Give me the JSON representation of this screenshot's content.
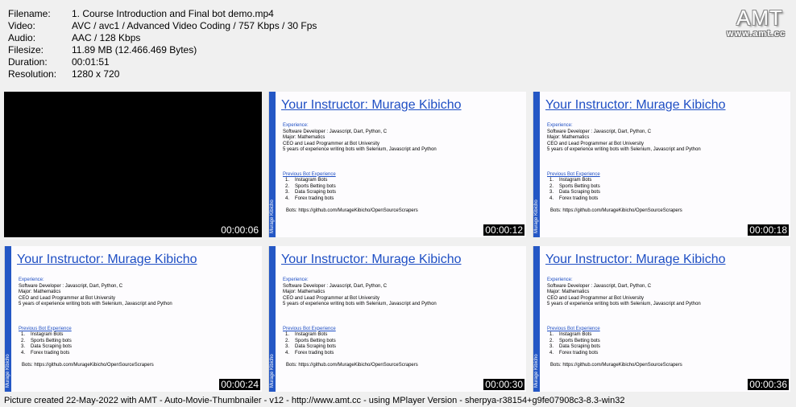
{
  "file_info": [
    {
      "key": "Filename:",
      "value": "1. Course Introduction and Final bot demo.mp4"
    },
    {
      "key": "Video:",
      "value": "AVC / avc1 / Advanced Video Coding / 757 Kbps / 30 Fps"
    },
    {
      "key": "Audio:",
      "value": "AAC / 128 Kbps"
    },
    {
      "key": "Filesize:",
      "value": "11.89 MB (12.466.469 Bytes)"
    },
    {
      "key": "Duration:",
      "value": "00:01:51"
    },
    {
      "key": "Resolution:",
      "value": "1280 x 720"
    }
  ],
  "logo": {
    "main": "AMT",
    "sub": "www.amt.cc"
  },
  "slide": {
    "title": "Your Instructor: Murage Kibicho",
    "experience_heading": "Experience:",
    "experience_lines": [
      "Software Developer : Javascript, Dart, Python, C",
      "Major: Mathematics",
      "CEO and Lead Programmer at Bot University",
      "5 years of experience writing bots with Selenium, Javascript and Python"
    ],
    "prev_heading": "Previous Bot Experience",
    "bots": [
      {
        "num": "1.",
        "label": "Instagram Bots"
      },
      {
        "num": "2.",
        "label": "Sports Betting bots"
      },
      {
        "num": "3.",
        "label": "Data Scraping bots"
      },
      {
        "num": "4.",
        "label": "Forex trading bots"
      }
    ],
    "bots_link": "Bots: https://github.com/MurageKibicho/OpenSourceScrapers",
    "sidebar_label": "Murage Kibicho"
  },
  "thumbnails": [
    {
      "timestamp": "00:00:06",
      "black": true
    },
    {
      "timestamp": "00:00:12",
      "black": false
    },
    {
      "timestamp": "00:00:18",
      "black": false
    },
    {
      "timestamp": "00:00:24",
      "black": false
    },
    {
      "timestamp": "00:00:30",
      "black": false
    },
    {
      "timestamp": "00:00:36",
      "black": false
    }
  ],
  "footer": "Picture created 22-May-2022 with AMT - Auto-Movie-Thumbnailer - v12 - http://www.amt.cc - using MPlayer Version - sherpya-r38154+g9fe07908c3-8.3-win32",
  "colors": {
    "accent": "#2457c5",
    "title": "#1f4fc4",
    "background": "#f0f0f0"
  }
}
